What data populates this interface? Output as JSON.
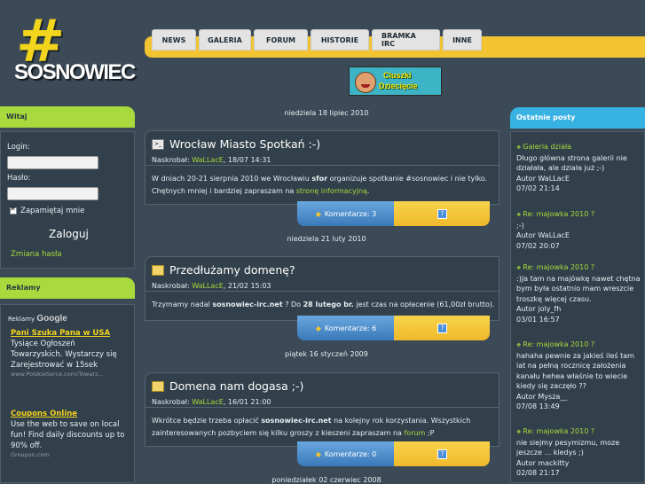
{
  "logo": {
    "hash": "#",
    "word": "SOSNOWIEC"
  },
  "nav": {
    "items": [
      "NEWS",
      "GALERIA",
      "FORUM",
      "HISTORIE",
      "BRAMKA IRC",
      "INNE"
    ]
  },
  "banner": {
    "line1": "Ciuszki",
    "line2": "Dziecięcie"
  },
  "login": {
    "heading": "Witaj",
    "login_label": "Login:",
    "password_label": "Hasło:",
    "remember_label": "Zapamiętaj mnie",
    "submit_label": "Zaloguj",
    "change_password": "Zmiana hasła"
  },
  "ads": {
    "heading": "Reklamy",
    "ads_by": "Reklamy",
    "google": "Google",
    "items": [
      {
        "title": "Pani Szuka Pana w USA",
        "text": "Tysiące Ogłoszeń Towarzyskich. Wystarczy się Zarejestrować w 15sek",
        "url": "www.PolskieSerce.com/Towarz..."
      },
      {
        "title": "Coupons Online",
        "text": "Use the web to save on local fun! Find daily discounts up to 90% off.",
        "url": "Groupon.com"
      }
    ]
  },
  "recent": {
    "heading": "Ostatnie posty",
    "posts": [
      {
        "title": "Galeria działa",
        "text": "Długo główna strona galerii nie działała, ale działa już ;-)",
        "author": "Autor WaLLacE",
        "date": "07/02 21:14"
      },
      {
        "title": "Re: majowka 2010 ?",
        "text": ";-)",
        "author": "Autor WaLLacE",
        "date": "07/02 20:07"
      },
      {
        "title": "Re: majowka 2010 ?",
        "text": ":)Ja tam na majówkę nawet chętna bym była ostatnio mam wreszcie troszkę więcej czasu.",
        "author": "Autor joly_fh",
        "date": "03/01 16:57"
      },
      {
        "title": "Re: majowka 2010 ?",
        "text": "hahaha pewnie za jakieś ileś tam lat na pełną rocznicę założenia kanału hehea właśnie to wiecie kiedy się zaczęło ??",
        "author": "Autor Mysza__",
        "date": "07/08 13:49"
      },
      {
        "title": "Re: majowka 2010 ?",
        "text": "nie siejmy pesymizmu, moze jeszcze ... kiedys ;)",
        "author": "Autor mackitty",
        "date": "02/08 21:17"
      }
    ]
  },
  "articles": [
    {
      "date": "niedziela 18 lipiec 2010",
      "title": "Wrocław Miasto Spotkań :-)",
      "meta_label": "Naskrobał:",
      "author": "WaLLacE",
      "meta_date": ", 18/07 14:31",
      "body_1": "W dniach 20-21 sierpnia 2010 we Wrocławiu ",
      "body_bold": "sfor",
      "body_2": " organizuje spotkanie #sosnowiec i nie tylko. Chętnych mniej i bardziej zapraszam na ",
      "body_link": "stronę informacyjną",
      "body_3": ".",
      "comments": "Komentarze: 3"
    },
    {
      "date": "niedziela 21 luty 2010",
      "title": "Przedłużamy domenę?",
      "meta_label": "Naskrobał:",
      "author": "WaLLacE",
      "meta_date": ", 21/02 15:03",
      "body_1": "Trzymamy nadal ",
      "body_bold": "sosnowiec-irc.net",
      "body_2": " ? Do ",
      "body_bold2": "28 lutego br.",
      "body_3": " jest czas na opłacenie (61,00zł brutto).",
      "comments": "Komentarze: 6"
    },
    {
      "date": "piątek 16 styczeń 2009",
      "title": "Domena nam dogasa ;-)",
      "meta_label": "Naskrobał:",
      "author": "WaLLacE",
      "meta_date": ", 16/01 21:00",
      "body_1": "Wkrótce będzie trzeba opłacić ",
      "body_bold": "sosnowiec-irc.net",
      "body_2": " na kolejny rok korzystania. Wszystkich zainteresowanych pozbyciem się kilku groszy z kieszeni zapraszam na ",
      "body_link": "forum",
      "body_3": " ;P",
      "comments": "Komentarze: 0"
    }
  ],
  "next_date": "poniedziałek 02 czerwiec 2008",
  "colors": {
    "background": "#3b4a56",
    "accent_yellow": "#f3c431",
    "accent_green": "#a8d93d",
    "accent_blue": "#38b2e2"
  }
}
